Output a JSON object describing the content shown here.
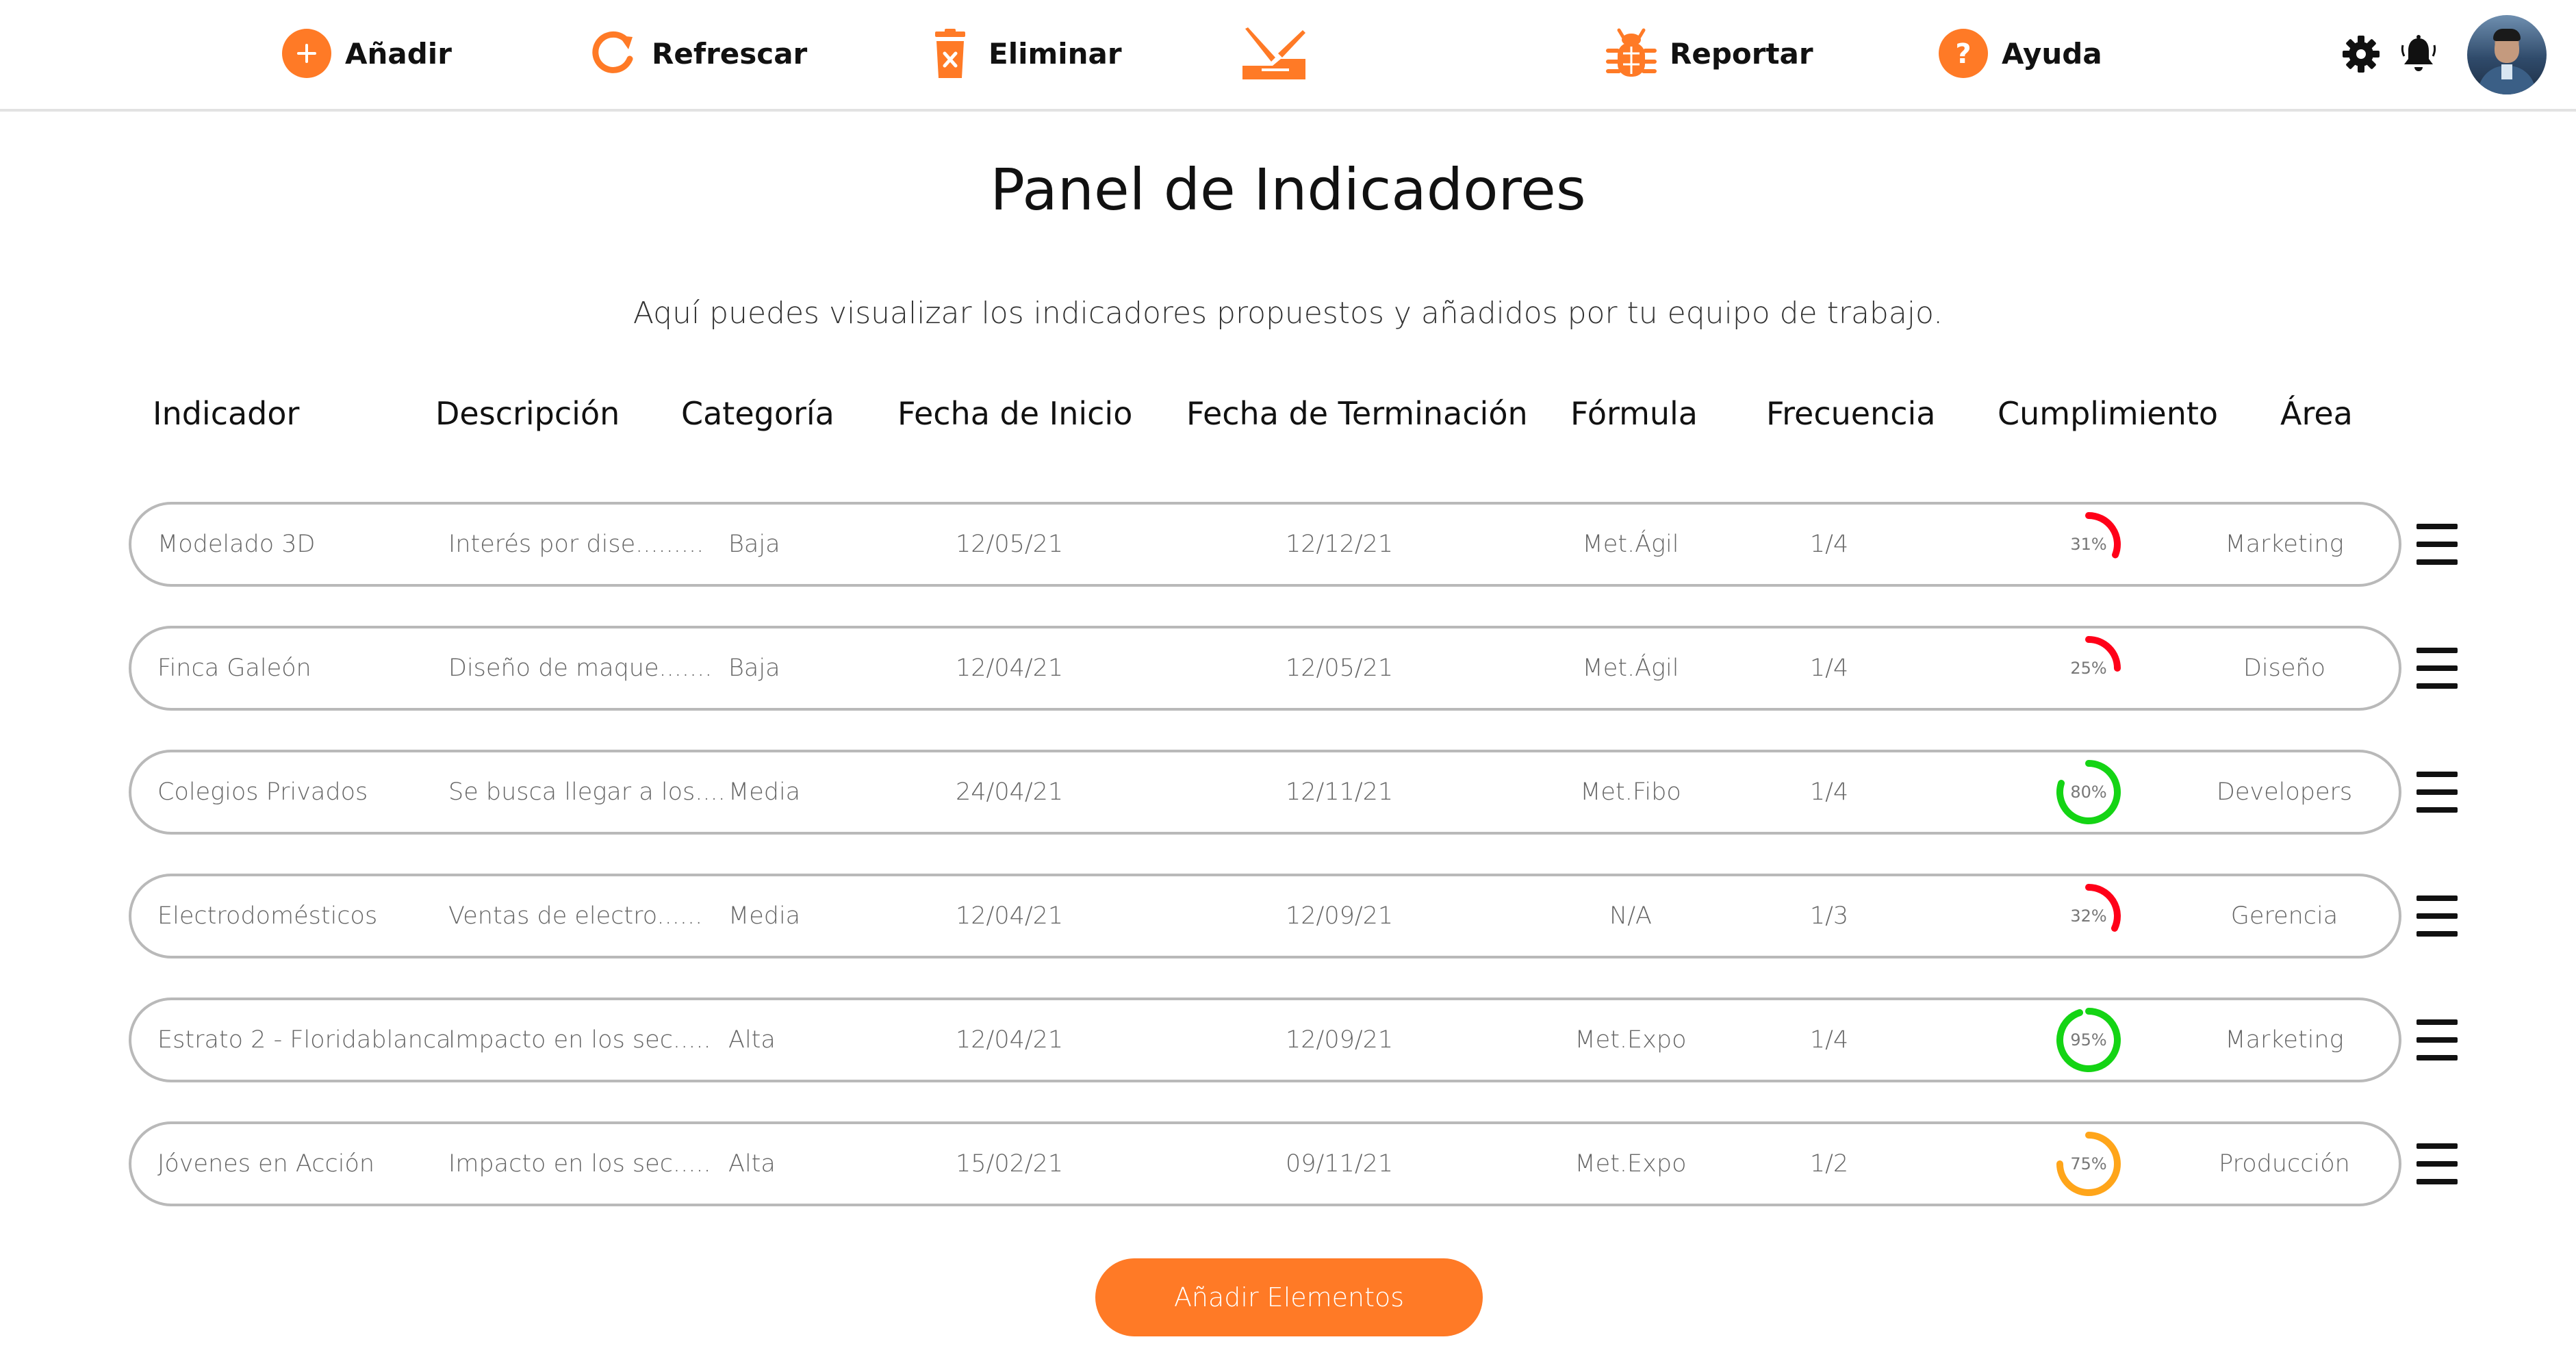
{
  "toolbar": {
    "add_label": "Añadir",
    "refresh_label": "Refrescar",
    "delete_label": "Eliminar",
    "report_label": "Reportar",
    "help_label": "Ayuda",
    "icons": {
      "add": "plus-circle-icon",
      "refresh": "refresh-icon",
      "delete": "trash-icon",
      "tool": "hammer-tool-icon",
      "report": "bug-icon",
      "help": "question-circle-icon",
      "settings": "gear-icon",
      "notifications": "bell-icon",
      "profile": "avatar"
    }
  },
  "colors": {
    "accent": "#ff7a26",
    "status_low": "#ff0018",
    "status_high": "#14d414",
    "status_mid": "#ffa51a",
    "row_border": "#b9b9b9"
  },
  "page": {
    "title": "Panel de Indicadores",
    "subtitle": "Aquí puedes visualizar los indicadores propuestos y añadidos por tu equipo de trabajo."
  },
  "table": {
    "headers": [
      "Indicador",
      "Descripción",
      "Categoría",
      "Fecha de Inicio",
      "Fecha de Terminación",
      "Fórmula",
      "Frecuencia",
      "Cumplimiento",
      "Área"
    ],
    "rows": [
      {
        "indicador": "Modelado 3D",
        "descripcion": "Interés por dise.........",
        "categoria": "Baja",
        "inicio": "12/05/21",
        "fin": "12/12/21",
        "formula": "Met.Ágil",
        "frecuencia": "1/4",
        "cumplimiento": 31,
        "cumplimiento_label": "31%",
        "status_color": "#ff0018",
        "area": "Marketing"
      },
      {
        "indicador": "Finca Galeón",
        "descripcion": "Diseño de maque.......",
        "categoria": "Baja",
        "inicio": "12/04/21",
        "fin": "12/05/21",
        "formula": "Met.Ágil",
        "frecuencia": "1/4",
        "cumplimiento": 25,
        "cumplimiento_label": "25%",
        "status_color": "#ff0018",
        "area": "Diseño"
      },
      {
        "indicador": "Colegios Privados",
        "descripcion": "Se busca llegar a los....",
        "categoria": "Media",
        "inicio": "24/04/21",
        "fin": "12/11/21",
        "formula": "Met.Fibo",
        "frecuencia": "1/4",
        "cumplimiento": 80,
        "cumplimiento_label": "80%",
        "status_color": "#14d414",
        "area": "Developers"
      },
      {
        "indicador": "Electrodomésticos",
        "descripcion": "Ventas de electro......",
        "categoria": "Media",
        "inicio": "12/04/21",
        "fin": "12/09/21",
        "formula": "N/A",
        "frecuencia": "1/3",
        "cumplimiento": 32,
        "cumplimiento_label": "32%",
        "status_color": "#ff0018",
        "area": "Gerencia"
      },
      {
        "indicador": "Estrato 2 - Floridablanca",
        "descripcion": "Impacto en los sec.....",
        "categoria": "Alta",
        "inicio": "12/04/21",
        "fin": "12/09/21",
        "formula": "Met.Expo",
        "frecuencia": "1/4",
        "cumplimiento": 95,
        "cumplimiento_label": "95%",
        "status_color": "#14d414",
        "area": "Marketing"
      },
      {
        "indicador": "Jóvenes en Acción",
        "descripcion": "Impacto en los sec.....",
        "categoria": "Alta",
        "inicio": "15/02/21",
        "fin": "09/11/21",
        "formula": "Met.Expo",
        "frecuencia": "1/2",
        "cumplimiento": 75,
        "cumplimiento_label": "75%",
        "status_color": "#ffa51a",
        "area": "Producción"
      }
    ],
    "row_menu_icon": "hamburger-menu-icon"
  },
  "footer": {
    "add_elements_label": "Añadir Elementos"
  }
}
